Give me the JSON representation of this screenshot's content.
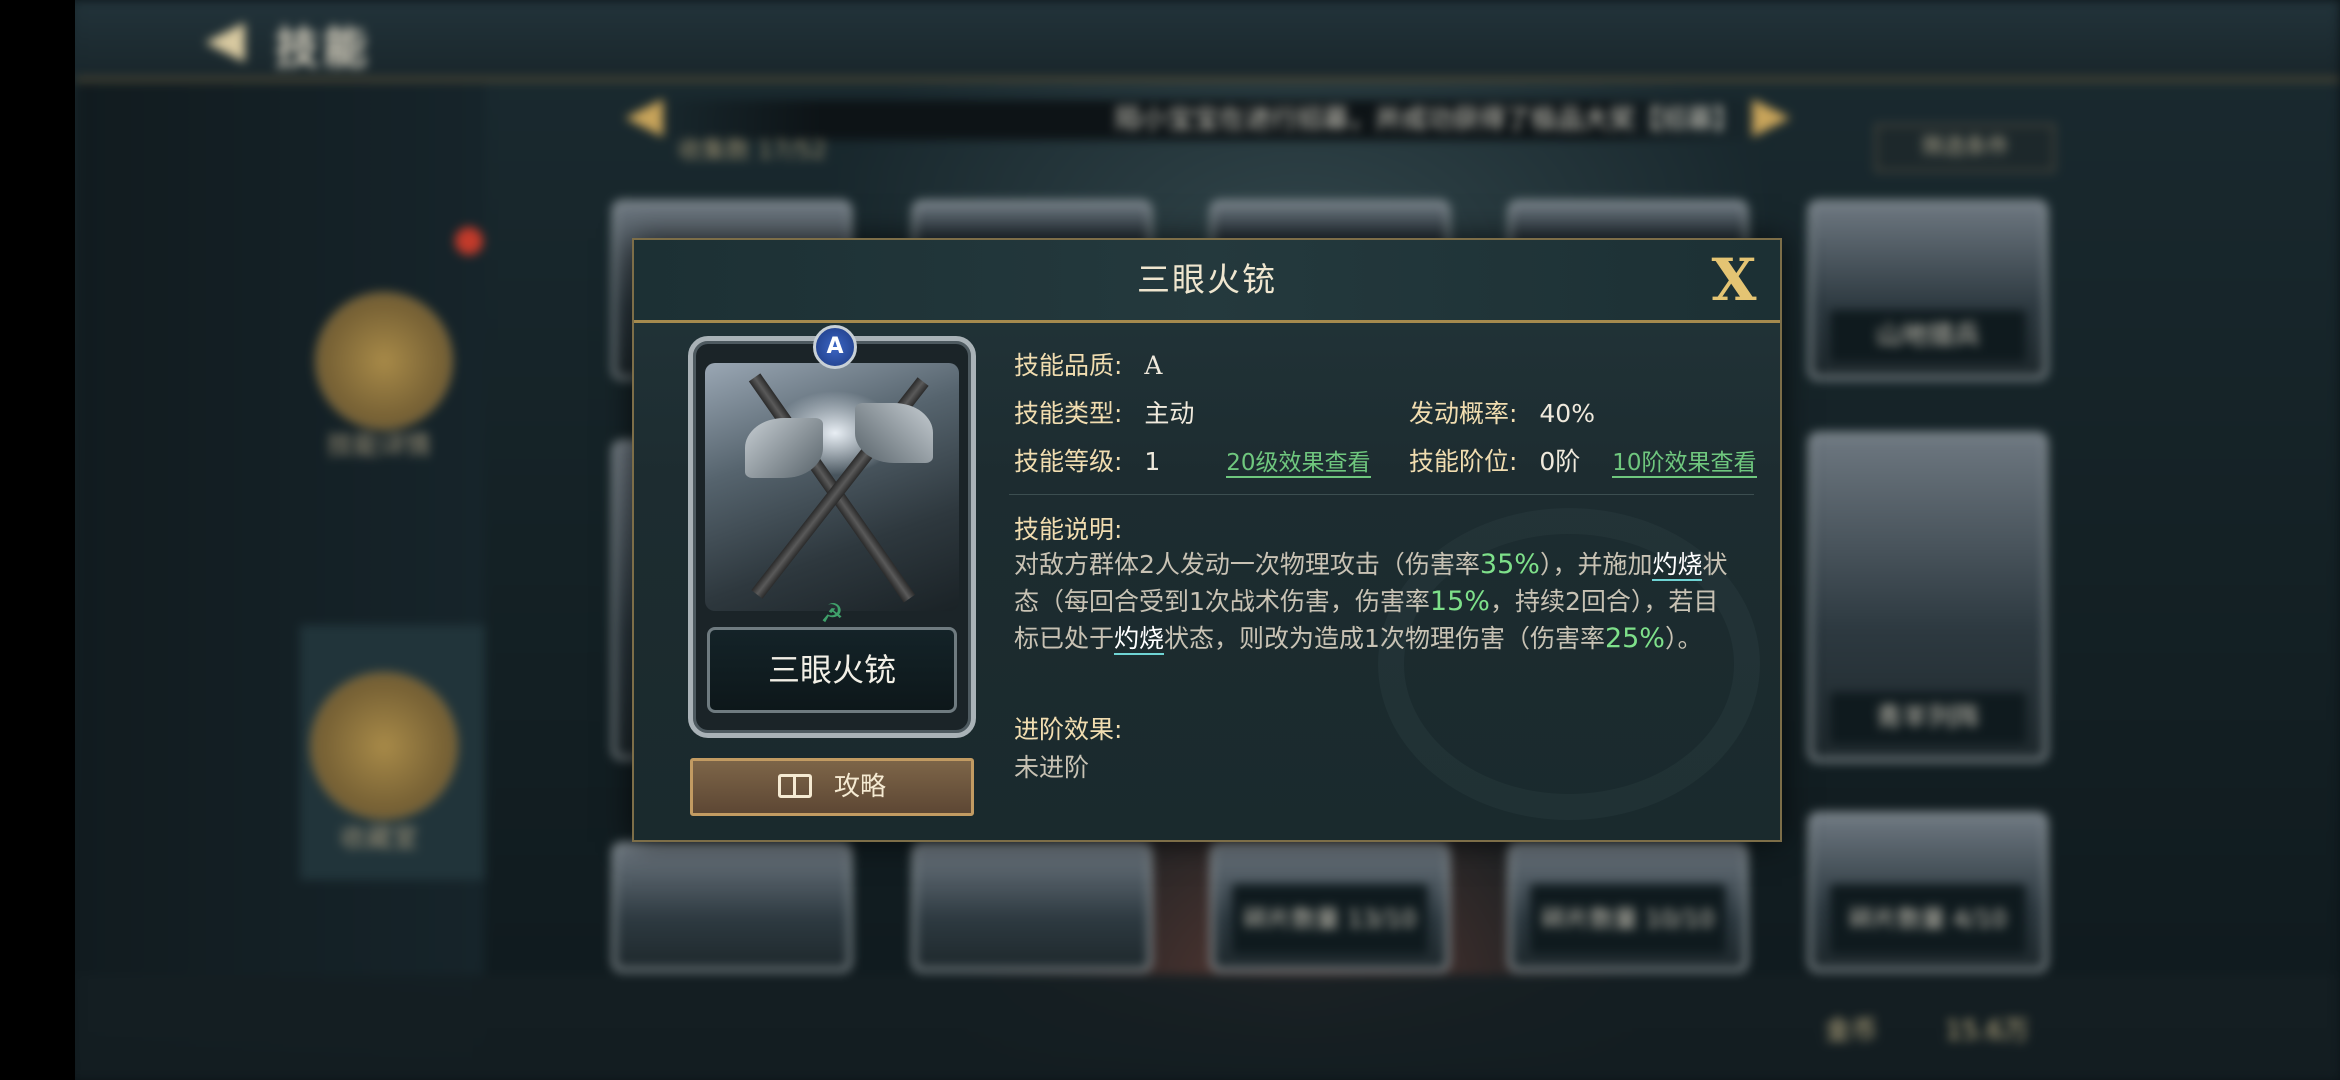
{
  "header": {
    "title": "技能"
  },
  "background": {
    "notice": "陌小宝宝在进行招募，并成功获得了极品大奖【招募】",
    "collection": "收集数 17/52",
    "filter_label": "筛选条件",
    "side_items": [
      {
        "label": "技能详情"
      },
      {
        "label": "收藏室"
      }
    ],
    "cards": [
      {
        "label": "山地猎兵"
      },
      {
        "label": "青羊列阵"
      },
      {
        "label": "碎片数量 13/10"
      },
      {
        "label": "碎片数量 10/10"
      },
      {
        "label": "碎片数量 4/10"
      }
    ],
    "currency_label": "金币",
    "currency_value": "15.6万"
  },
  "modal": {
    "title": "三眼火铳",
    "close_label": "X",
    "card": {
      "rank": "A",
      "name": "三眼火铳"
    },
    "guide_label": "攻略",
    "quality": {
      "label": "技能品质:",
      "value": "A"
    },
    "type": {
      "label": "技能类型:",
      "value": "主动"
    },
    "chance": {
      "label": "发动概率:",
      "value": "40%"
    },
    "level": {
      "label": "技能等级:",
      "value": "1",
      "link": "20级效果查看"
    },
    "rank": {
      "label": "技能阶位:",
      "value": "0阶",
      "link": "10阶效果查看"
    },
    "desc_title": "技能说明:",
    "desc": {
      "p1": "对敌方群体2人发动一次物理攻击（伤害率",
      "v1": "35%",
      "p2": "），并施加",
      "kw1": "灼烧",
      "p3": "状态（每回合受到1次战术伤害，伤害率",
      "v2": "15%",
      "p4": "，持续2回合），若目标已处于",
      "kw2": "灼烧",
      "p5": "状态，则改为造成1次物理伤害（伤害率",
      "v3": "25%",
      "p6": "）。"
    },
    "advance_title": "进阶效果:",
    "advance_value": "未进阶"
  },
  "colors": {
    "accent_gold": "#e4c473",
    "highlight_green": "#7ee08a",
    "label_gold": "#f1ddb0"
  }
}
